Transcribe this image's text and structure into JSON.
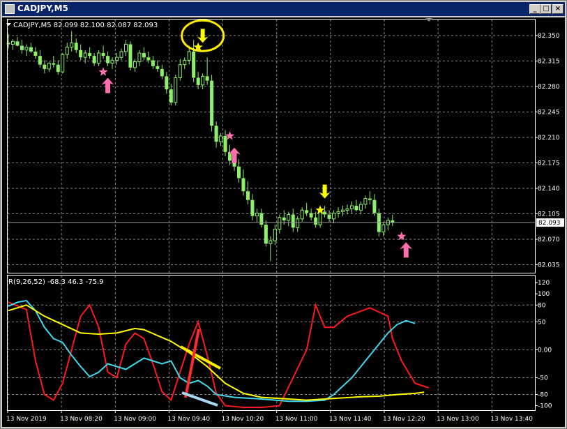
{
  "window": {
    "title": "CADJPY,M5",
    "buttons": {
      "minimize": "_",
      "maximize": "□",
      "close": "×"
    }
  },
  "colors": {
    "background": "#000000",
    "grid": "#8a8a8a",
    "axis_text": "#ffffff",
    "candle": "#8cf06a",
    "bid_line": "#9a9a9a",
    "rsi_red": "#ff1a1a",
    "rsi_cyan": "#3fd9ee",
    "rsi_yellow": "#ffff00",
    "star_pink": "#ff6fb0",
    "star_yellow": "#ffff00",
    "annotation_ellipse": "#ffee00",
    "annotation_red": "#ff2a2a",
    "annotation_yellow": "#ffee00",
    "annotation_blue": "#a8d8f0"
  },
  "chart_data": [
    {
      "type": "candlestick",
      "title": "CADJPY,M5 82.099 82.100 82.087 82.093",
      "y_ticks": [
        "82.350",
        "82.315",
        "82.280",
        "82.245",
        "82.210",
        "82.175",
        "82.140",
        "82.105",
        "82.070",
        "82.035"
      ],
      "ylim": [
        82.024,
        82.372
      ],
      "current_price": "82.093",
      "candles": [
        {
          "o": 82.34,
          "h": 82.352,
          "l": 82.332,
          "c": 82.338
        },
        {
          "o": 82.338,
          "h": 82.345,
          "l": 82.33,
          "c": 82.342
        },
        {
          "o": 82.342,
          "h": 82.348,
          "l": 82.335,
          "c": 82.336
        },
        {
          "o": 82.336,
          "h": 82.344,
          "l": 82.325,
          "c": 82.33
        },
        {
          "o": 82.33,
          "h": 82.338,
          "l": 82.322,
          "c": 82.334
        },
        {
          "o": 82.334,
          "h": 82.34,
          "l": 82.326,
          "c": 82.328
        },
        {
          "o": 82.328,
          "h": 82.334,
          "l": 82.318,
          "c": 82.322
        },
        {
          "o": 82.322,
          "h": 82.33,
          "l": 82.306,
          "c": 82.31
        },
        {
          "o": 82.31,
          "h": 82.316,
          "l": 82.298,
          "c": 82.304
        },
        {
          "o": 82.304,
          "h": 82.314,
          "l": 82.3,
          "c": 82.312
        },
        {
          "o": 82.312,
          "h": 82.322,
          "l": 82.306,
          "c": 82.31
        },
        {
          "o": 82.31,
          "h": 82.316,
          "l": 82.296,
          "c": 82.3
        },
        {
          "o": 82.3,
          "h": 82.326,
          "l": 82.298,
          "c": 82.324
        },
        {
          "o": 82.324,
          "h": 82.34,
          "l": 82.318,
          "c": 82.334
        },
        {
          "o": 82.334,
          "h": 82.356,
          "l": 82.328,
          "c": 82.34
        },
        {
          "o": 82.34,
          "h": 82.346,
          "l": 82.326,
          "c": 82.33
        },
        {
          "o": 82.33,
          "h": 82.338,
          "l": 82.316,
          "c": 82.32
        },
        {
          "o": 82.32,
          "h": 82.33,
          "l": 82.312,
          "c": 82.326
        },
        {
          "o": 82.326,
          "h": 82.334,
          "l": 82.318,
          "c": 82.322
        },
        {
          "o": 82.322,
          "h": 82.326,
          "l": 82.308,
          "c": 82.312
        },
        {
          "o": 82.312,
          "h": 82.33,
          "l": 82.308,
          "c": 82.326
        },
        {
          "o": 82.326,
          "h": 82.336,
          "l": 82.318,
          "c": 82.322
        },
        {
          "o": 82.322,
          "h": 82.328,
          "l": 82.308,
          "c": 82.312
        },
        {
          "o": 82.312,
          "h": 82.32,
          "l": 82.304,
          "c": 82.316
        },
        {
          "o": 82.316,
          "h": 82.326,
          "l": 82.31,
          "c": 82.32
        },
        {
          "o": 82.32,
          "h": 82.332,
          "l": 82.316,
          "c": 82.328
        },
        {
          "o": 82.328,
          "h": 82.344,
          "l": 82.322,
          "c": 82.338
        },
        {
          "o": 82.338,
          "h": 82.342,
          "l": 82.302,
          "c": 82.306
        },
        {
          "o": 82.306,
          "h": 82.318,
          "l": 82.3,
          "c": 82.314
        },
        {
          "o": 82.314,
          "h": 82.33,
          "l": 82.308,
          "c": 82.326
        },
        {
          "o": 82.326,
          "h": 82.334,
          "l": 82.316,
          "c": 82.32
        },
        {
          "o": 82.32,
          "h": 82.328,
          "l": 82.312,
          "c": 82.316
        },
        {
          "o": 82.316,
          "h": 82.322,
          "l": 82.304,
          "c": 82.308
        },
        {
          "o": 82.308,
          "h": 82.316,
          "l": 82.3,
          "c": 82.304
        },
        {
          "o": 82.304,
          "h": 82.31,
          "l": 82.29,
          "c": 82.294
        },
        {
          "o": 82.294,
          "h": 82.3,
          "l": 82.27,
          "c": 82.276
        },
        {
          "o": 82.276,
          "h": 82.284,
          "l": 82.254,
          "c": 82.258
        },
        {
          "o": 82.258,
          "h": 82.296,
          "l": 82.254,
          "c": 82.292
        },
        {
          "o": 82.292,
          "h": 82.318,
          "l": 82.288,
          "c": 82.31
        },
        {
          "o": 82.31,
          "h": 82.32,
          "l": 82.304,
          "c": 82.316
        },
        {
          "o": 82.316,
          "h": 82.336,
          "l": 82.31,
          "c": 82.328
        },
        {
          "o": 82.328,
          "h": 82.344,
          "l": 82.286,
          "c": 82.292
        },
        {
          "o": 82.292,
          "h": 82.3,
          "l": 82.276,
          "c": 82.282
        },
        {
          "o": 82.282,
          "h": 82.298,
          "l": 82.276,
          "c": 82.294
        },
        {
          "o": 82.294,
          "h": 82.32,
          "l": 82.282,
          "c": 82.288
        },
        {
          "o": 82.288,
          "h": 82.296,
          "l": 82.218,
          "c": 82.226
        },
        {
          "o": 82.226,
          "h": 82.232,
          "l": 82.196,
          "c": 82.204
        },
        {
          "o": 82.204,
          "h": 82.216,
          "l": 82.198,
          "c": 82.212
        },
        {
          "o": 82.212,
          "h": 82.22,
          "l": 82.184,
          "c": 82.19
        },
        {
          "o": 82.19,
          "h": 82.2,
          "l": 82.172,
          "c": 82.178
        },
        {
          "o": 82.178,
          "h": 82.186,
          "l": 82.164,
          "c": 82.17
        },
        {
          "o": 82.17,
          "h": 82.18,
          "l": 82.148,
          "c": 82.154
        },
        {
          "o": 82.154,
          "h": 82.166,
          "l": 82.13,
          "c": 82.136
        },
        {
          "o": 82.136,
          "h": 82.15,
          "l": 82.118,
          "c": 82.124
        },
        {
          "o": 82.124,
          "h": 82.132,
          "l": 82.096,
          "c": 82.102
        },
        {
          "o": 82.102,
          "h": 82.112,
          "l": 82.094,
          "c": 82.106
        },
        {
          "o": 82.106,
          "h": 82.112,
          "l": 82.086,
          "c": 82.09
        },
        {
          "o": 82.09,
          "h": 82.096,
          "l": 82.06,
          "c": 82.064
        },
        {
          "o": 82.064,
          "h": 82.074,
          "l": 82.04,
          "c": 82.068
        },
        {
          "o": 82.068,
          "h": 82.09,
          "l": 82.062,
          "c": 82.084
        },
        {
          "o": 82.084,
          "h": 82.104,
          "l": 82.078,
          "c": 82.1
        },
        {
          "o": 82.1,
          "h": 82.11,
          "l": 82.09,
          "c": 82.096
        },
        {
          "o": 82.096,
          "h": 82.108,
          "l": 82.088,
          "c": 82.104
        },
        {
          "o": 82.104,
          "h": 82.112,
          "l": 82.08,
          "c": 82.086
        },
        {
          "o": 82.086,
          "h": 82.102,
          "l": 82.08,
          "c": 82.098
        },
        {
          "o": 82.098,
          "h": 82.114,
          "l": 82.094,
          "c": 82.11
        },
        {
          "o": 82.11,
          "h": 82.12,
          "l": 82.102,
          "c": 82.106
        },
        {
          "o": 82.106,
          "h": 82.112,
          "l": 82.096,
          "c": 82.1
        },
        {
          "o": 82.1,
          "h": 82.108,
          "l": 82.086,
          "c": 82.09
        },
        {
          "o": 82.09,
          "h": 82.112,
          "l": 82.086,
          "c": 82.108
        },
        {
          "o": 82.108,
          "h": 82.116,
          "l": 82.1,
          "c": 82.104
        },
        {
          "o": 82.104,
          "h": 82.11,
          "l": 82.094,
          "c": 82.098
        },
        {
          "o": 82.098,
          "h": 82.11,
          "l": 82.092,
          "c": 82.106
        },
        {
          "o": 82.106,
          "h": 82.114,
          "l": 82.1,
          "c": 82.108
        },
        {
          "o": 82.108,
          "h": 82.116,
          "l": 82.102,
          "c": 82.11
        },
        {
          "o": 82.11,
          "h": 82.118,
          "l": 82.104,
          "c": 82.112
        },
        {
          "o": 82.112,
          "h": 82.122,
          "l": 82.106,
          "c": 82.116
        },
        {
          "o": 82.116,
          "h": 82.124,
          "l": 82.108,
          "c": 82.11
        },
        {
          "o": 82.11,
          "h": 82.122,
          "l": 82.104,
          "c": 82.118
        },
        {
          "o": 82.118,
          "h": 82.13,
          "l": 82.112,
          "c": 82.126
        },
        {
          "o": 82.126,
          "h": 82.136,
          "l": 82.118,
          "c": 82.124
        },
        {
          "o": 82.124,
          "h": 82.132,
          "l": 82.102,
          "c": 82.106
        },
        {
          "o": 82.106,
          "h": 82.112,
          "l": 82.074,
          "c": 82.08
        },
        {
          "o": 82.08,
          "h": 82.094,
          "l": 82.074,
          "c": 82.09
        },
        {
          "o": 82.09,
          "h": 82.1,
          "l": 82.082,
          "c": 82.096
        },
        {
          "o": 82.096,
          "h": 82.104,
          "l": 82.088,
          "c": 82.093
        }
      ],
      "markers": [
        {
          "kind": "star",
          "color": "pink",
          "bar": 21,
          "price": 82.3
        },
        {
          "kind": "up-arrow",
          "color": "pink",
          "bar": 22,
          "price": 82.292
        },
        {
          "kind": "ellipse",
          "bar": 43,
          "price": 82.344
        },
        {
          "kind": "star",
          "color": "yellow",
          "bar": 42,
          "price": 82.334
        },
        {
          "kind": "down-arrow",
          "color": "yellow",
          "bar": 43,
          "price": 82.34
        },
        {
          "kind": "star",
          "color": "pink",
          "bar": 49,
          "price": 82.212
        },
        {
          "kind": "up-arrow",
          "color": "pink",
          "bar": 50,
          "price": 82.196
        },
        {
          "kind": "star",
          "color": "yellow",
          "bar": 69,
          "price": 82.11
        },
        {
          "kind": "down-arrow",
          "color": "yellow",
          "bar": 70,
          "price": 82.126
        },
        {
          "kind": "star",
          "color": "pink",
          "bar": 87,
          "price": 82.074
        },
        {
          "kind": "up-arrow",
          "color": "pink",
          "bar": 88,
          "price": 82.066
        }
      ]
    },
    {
      "type": "line",
      "title": "R(9,26,52) -68.3 46.3 -75.9",
      "y_ticks": [
        "120",
        "100",
        "80",
        "50",
        "0.00",
        "-50",
        "-80",
        "-100"
      ],
      "ylim": [
        -108,
        124
      ],
      "grid_values": [
        80,
        50,
        0,
        -50,
        -80
      ],
      "x_tick_labels": [
        "13 Nov 2019",
        "13 Nov 08:20",
        "13 Nov 09:00",
        "13 Nov 09:40",
        "13 Nov 10:20",
        "13 Nov 11:00",
        "13 Nov 11:40",
        "13 Nov 12:20",
        "13 Nov 13:00",
        "13 Nov 13:40"
      ],
      "series": [
        {
          "id": "red",
          "points": [
            [
              0,
              85
            ],
            [
              4,
              72
            ],
            [
              6,
              -20
            ],
            [
              8,
              -80
            ],
            [
              10,
              -90
            ],
            [
              12,
              -60
            ],
            [
              14,
              0
            ],
            [
              16,
              60
            ],
            [
              18,
              80
            ],
            [
              20,
              40
            ],
            [
              22,
              -40
            ],
            [
              24,
              -50
            ],
            [
              26,
              10
            ],
            [
              28,
              30
            ],
            [
              30,
              20
            ],
            [
              32,
              -25
            ],
            [
              34,
              -75
            ],
            [
              36,
              -90
            ],
            [
              38,
              -40
            ],
            [
              40,
              10
            ],
            [
              42,
              50
            ],
            [
              44,
              -10
            ],
            [
              46,
              -78
            ],
            [
              48,
              -100
            ],
            [
              52,
              -103
            ],
            [
              56,
              -103
            ],
            [
              60,
              -100
            ],
            [
              63,
              -50
            ],
            [
              66,
              0
            ],
            [
              68,
              80
            ],
            [
              70,
              40
            ],
            [
              72,
              40
            ],
            [
              75,
              60
            ],
            [
              80,
              75
            ],
            [
              84,
              60
            ],
            [
              85,
              20
            ],
            [
              87,
              -20
            ],
            [
              90,
              -60
            ],
            [
              93,
              -68
            ]
          ]
        },
        {
          "id": "cyan",
          "points": [
            [
              0,
              78
            ],
            [
              2,
              85
            ],
            [
              4,
              88
            ],
            [
              6,
              70
            ],
            [
              8,
              40
            ],
            [
              10,
              20
            ],
            [
              12,
              13
            ],
            [
              14,
              -10
            ],
            [
              16,
              -30
            ],
            [
              18,
              -48
            ],
            [
              20,
              -40
            ],
            [
              22,
              -25
            ],
            [
              26,
              -35
            ],
            [
              30,
              -15
            ],
            [
              34,
              -25
            ],
            [
              36,
              -20
            ],
            [
              38,
              -50
            ],
            [
              40,
              -60
            ],
            [
              42,
              -55
            ],
            [
              44,
              -65
            ],
            [
              46,
              -80
            ],
            [
              50,
              -85
            ],
            [
              56,
              -88
            ],
            [
              62,
              -92
            ],
            [
              66,
              -92
            ],
            [
              70,
              -90
            ],
            [
              72,
              -80
            ],
            [
              76,
              -50
            ],
            [
              80,
              -10
            ],
            [
              84,
              30
            ],
            [
              86,
              45
            ],
            [
              88,
              52
            ],
            [
              90,
              47
            ]
          ]
        },
        {
          "id": "yellow",
          "points": [
            [
              0,
              70
            ],
            [
              4,
              80
            ],
            [
              8,
              60
            ],
            [
              12,
              45
            ],
            [
              16,
              30
            ],
            [
              20,
              28
            ],
            [
              24,
              30
            ],
            [
              28,
              38
            ],
            [
              30,
              36
            ],
            [
              36,
              15
            ],
            [
              40,
              -5
            ],
            [
              44,
              -30
            ],
            [
              48,
              -60
            ],
            [
              52,
              -78
            ],
            [
              56,
              -85
            ],
            [
              62,
              -88
            ],
            [
              66,
              -90
            ],
            [
              70,
              -88
            ],
            [
              74,
              -86
            ],
            [
              78,
              -84
            ],
            [
              82,
              -83
            ],
            [
              86,
              -80
            ],
            [
              90,
              -78
            ],
            [
              92,
              -76
            ]
          ]
        }
      ]
    }
  ]
}
